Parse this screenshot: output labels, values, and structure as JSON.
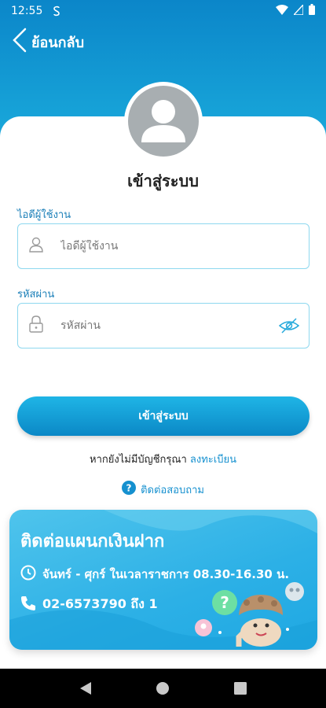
{
  "status_bar": {
    "time": "12:55"
  },
  "header": {
    "back_label": "ย้อนกลับ"
  },
  "login": {
    "title": "เข้าสู่ระบบ",
    "username_label": "ไอดีผู้ใช้งาน",
    "username_placeholder": "ไอดีผู้ใช้งาน",
    "password_label": "รหัสผ่าน",
    "password_placeholder": "รหัสผ่าน",
    "submit_label": "เข้าสู่ระบบ",
    "register_prompt": "หากยังไม่มีบัญชีกรุณา",
    "register_link": "ลงทะเบียน",
    "contact_link": "ติดต่อสอบถาม"
  },
  "contact_card": {
    "title": "ติดต่อแผนกเงินฝาก",
    "hours": "จันทร์ - ศุกร์ ในเวลาราชการ 08.30-16.30 น.",
    "phone": "02-6573790 ถึง 1"
  },
  "colors": {
    "primary": "#0b88c6",
    "accent": "#1590cf",
    "field_border": "#8ed8ef",
    "card_bg": "#2cb0e6"
  },
  "icons": {
    "back": "chevron-left-icon",
    "user": "user-icon",
    "lock": "lock-icon",
    "eye": "eye-off-icon",
    "help": "question-circle-icon",
    "clock": "clock-icon",
    "phone": "phone-icon"
  }
}
